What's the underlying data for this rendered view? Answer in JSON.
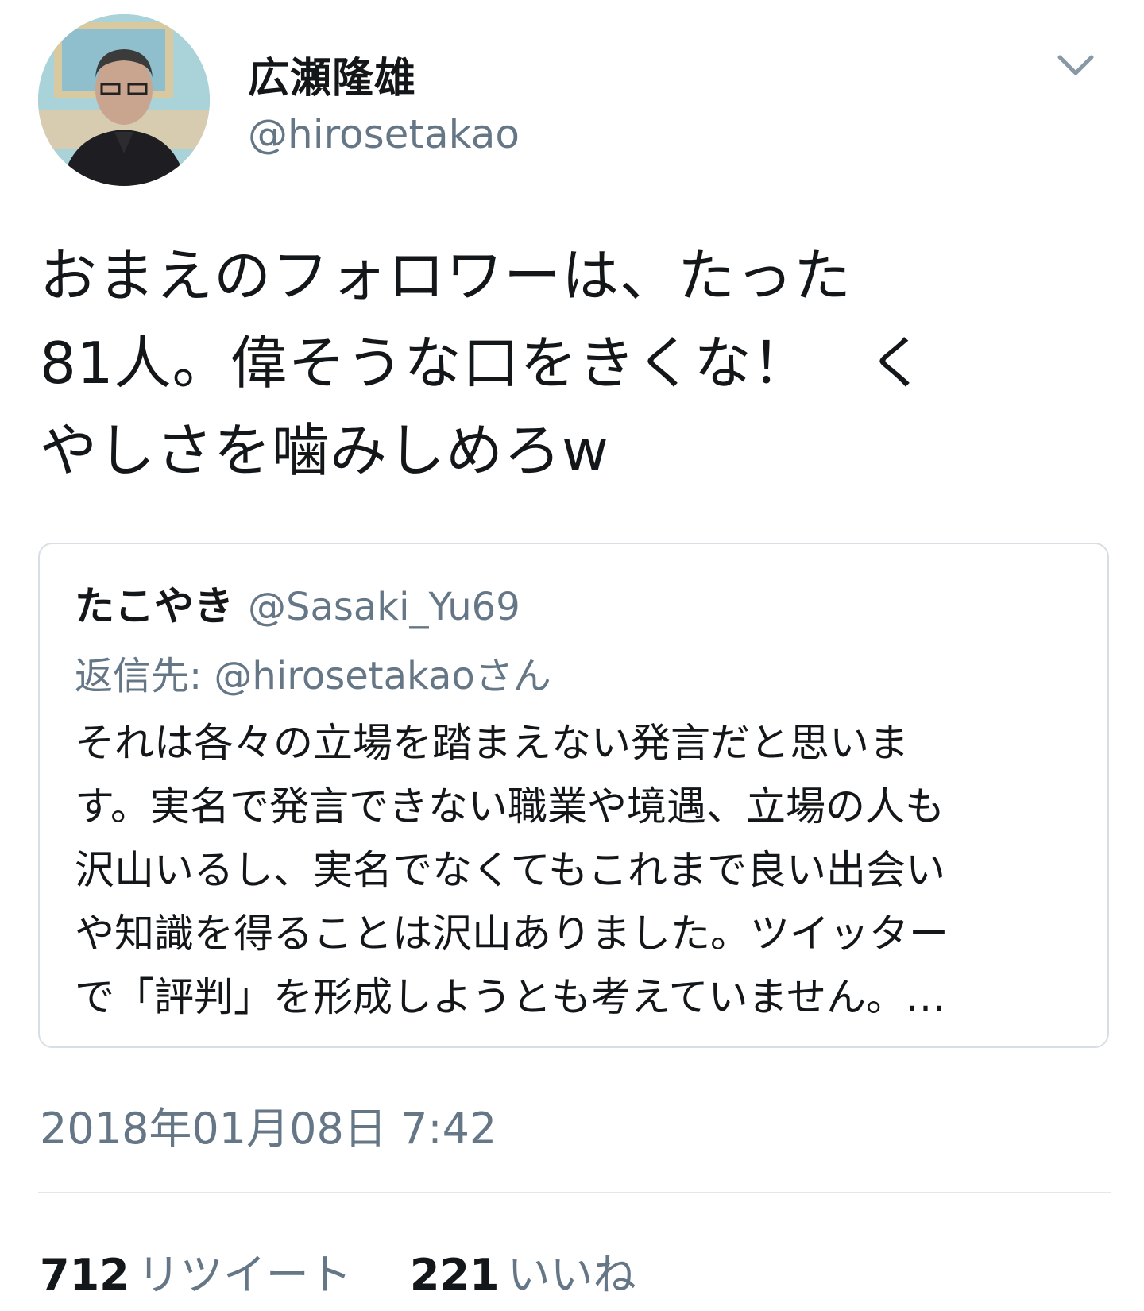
{
  "tweet": {
    "author": {
      "display_name": "広瀬隆雄",
      "handle": "@hirosetakao",
      "avatar_icon": "profile-photo"
    },
    "menu_icon": "chevron-down-icon",
    "text": "おまえのフォロワーは、たった\n81人。偉そうな口をきくな！　く\nやしさを噛みしめろw",
    "timestamp": "2018年01月08日 7:42",
    "stats": {
      "retweets_count": "712",
      "retweets_label": "リツイート",
      "likes_count": "221",
      "likes_label": "いいね"
    }
  },
  "quoted_tweet": {
    "display_name": "たこやき",
    "handle": "@Sasaki_Yu69",
    "reply_to": "返信先: @hirosetakaoさん",
    "text": "それは各々の立場を踏まえない発言だと思いま\nす。実名で発言できない職業や境遇、立場の人も\n沢山いるし、実名でなくてもこれまで良い出会い\nや知識を得ることは沢山ありました。ツイッター\nで「評判」を形成しようとも考えていません。…"
  },
  "colors": {
    "text_primary": "#14171a",
    "text_secondary": "#657786",
    "border": "#d8dee4"
  }
}
